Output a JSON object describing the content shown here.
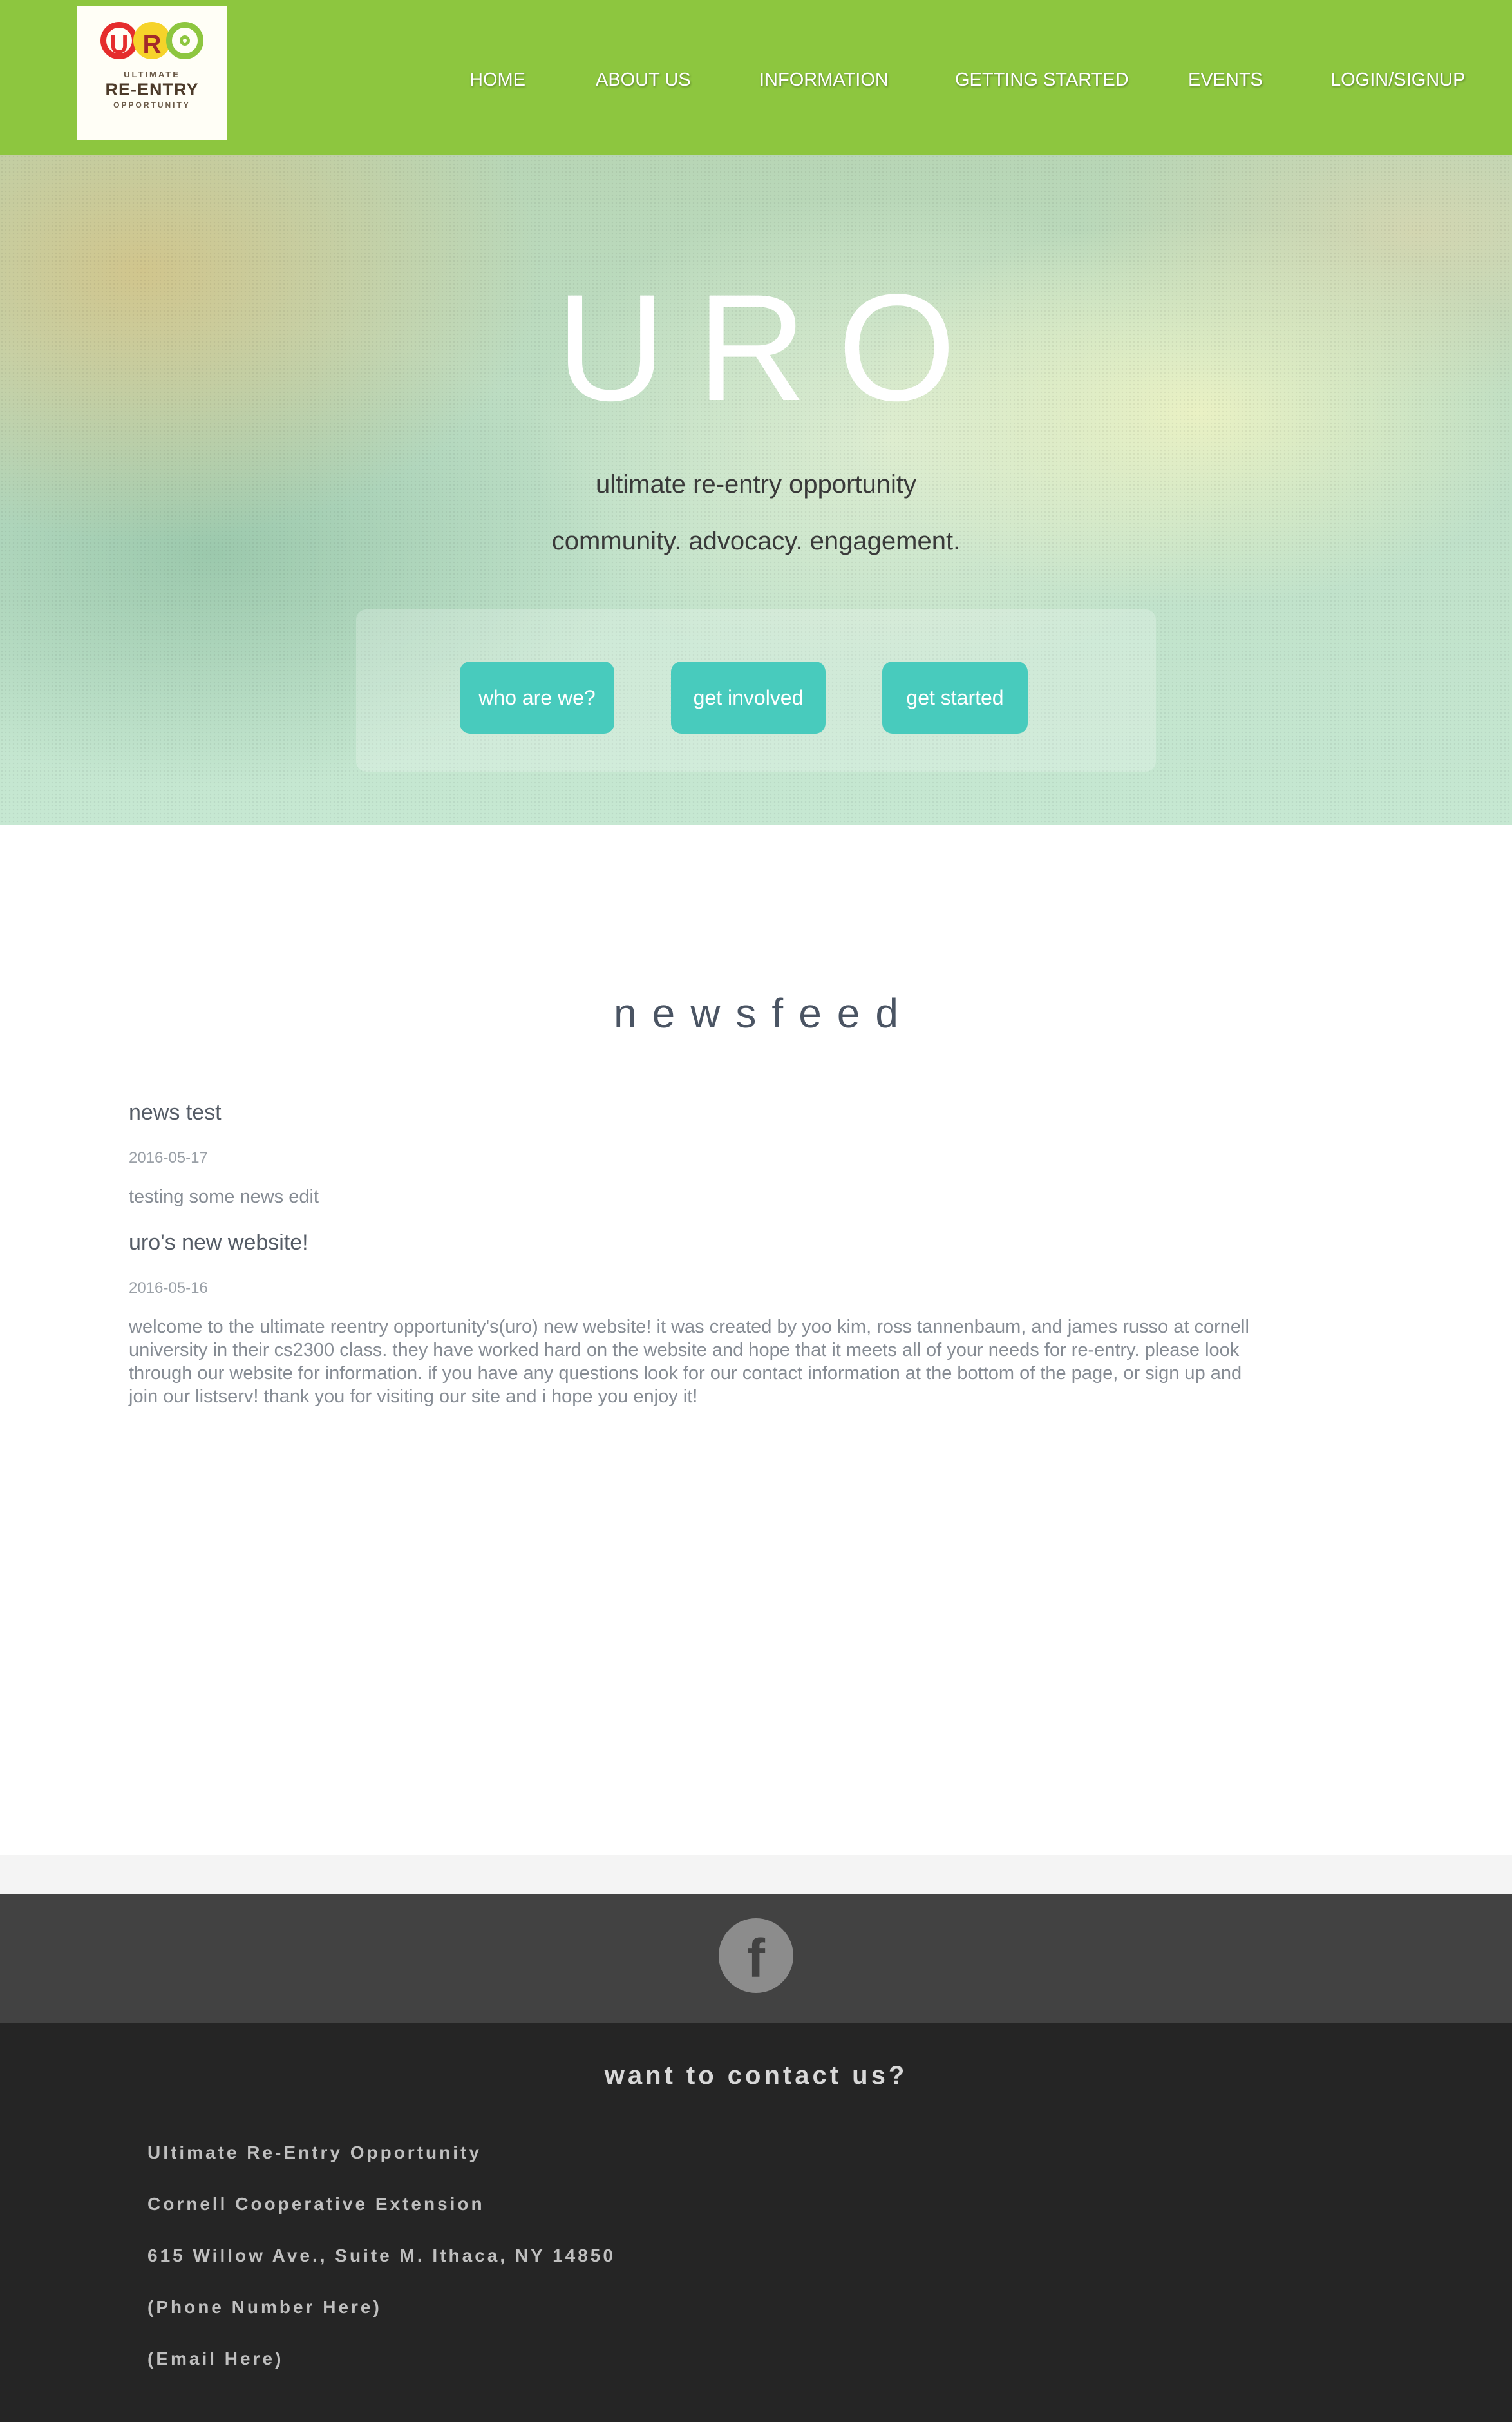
{
  "brand": {
    "logo_letters": [
      "U",
      "R",
      "O"
    ],
    "logo_line1": "ULTIMATE",
    "logo_line2": "RE-ENTRY",
    "logo_line3": "OPPORTUNITY",
    "colors": {
      "nav_green": "#8dc63f",
      "logo_red": "#e52d2d",
      "logo_yellow": "#f6d32a",
      "teal_button": "#48cbbd"
    }
  },
  "nav": {
    "items": [
      "HOME",
      "ABOUT US",
      "INFORMATION",
      "GETTING STARTED",
      "EVENTS",
      "LOGIN/SIGNUP"
    ]
  },
  "hero": {
    "title": "URO",
    "subtitle": "ultimate re-entry opportunity",
    "tagline": "community. advocacy. engagement.",
    "buttons": [
      "who are we?",
      "get involved",
      "get started"
    ]
  },
  "newsfeed": {
    "title": "newsfeed",
    "items": [
      {
        "title": "news test",
        "date": "2016-05-17",
        "body": "testing some news edit"
      },
      {
        "title": "uro's new website!",
        "date": "2016-05-16",
        "body": "welcome to the ultimate reentry opportunity's(uro) new website! it was created by yoo kim, ross tannenbaum, and james russo at cornell university in their cs2300 class. they have worked hard on the website and hope that it meets all of your needs for re-entry. please look through our website for information. if you have any questions look for our contact information at the bottom of the page, or sign up and join our listserv! thank you for visiting our site and i hope you enjoy it!"
      }
    ]
  },
  "social": {
    "facebook_icon": "facebook-icon",
    "facebook_glyph": "f"
  },
  "contact": {
    "title": "want to contact us?",
    "lines": [
      "Ultimate Re-Entry Opportunity",
      "Cornell Cooperative Extension",
      "615 Willow Ave., Suite M. Ithaca, NY 14850",
      "(Phone Number Here)",
      "(Email Here)"
    ]
  }
}
